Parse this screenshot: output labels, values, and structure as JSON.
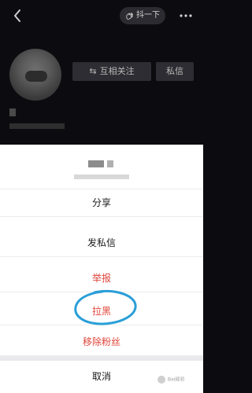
{
  "header": {
    "back_icon": "chevron-left-icon",
    "shake_label": "抖一下",
    "shake_icon": "hand-wave-icon",
    "more_icon": "more-dots-icon"
  },
  "profile": {
    "mutual_follow_label": "互相关注",
    "mutual_follow_icon": "swap-arrows-icon",
    "message_label": "私信"
  },
  "action_sheet": {
    "options": [
      {
        "label": "分享",
        "color": "#1a1a1a"
      },
      {
        "label": "发私信",
        "color": "#1a1a1a"
      },
      {
        "label": "举报",
        "color": "#e0453a"
      },
      {
        "label": "拉黑",
        "color": "#e0453a"
      },
      {
        "label": "移除粉丝",
        "color": "#e0453a"
      }
    ],
    "cancel_label": "取消"
  },
  "annotation": {
    "color": "#2a9fd8"
  },
  "watermark": {
    "text": "Bai経验"
  }
}
